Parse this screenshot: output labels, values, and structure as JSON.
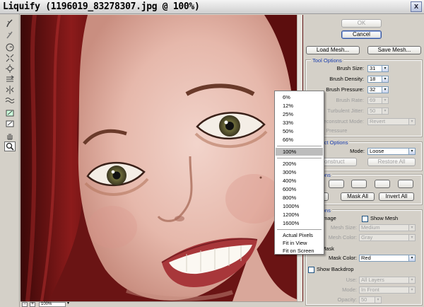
{
  "window": {
    "title": "Liquify (1196019_83278307.jpg @ 100%)",
    "close_glyph": "x"
  },
  "tools": [
    "warp-icon",
    "reconstruct-icon",
    "twirl-icon",
    "pucker-icon",
    "bloat-icon",
    "push-left-icon",
    "mirror-icon",
    "turbulence-icon",
    "freeze-mask-icon",
    "thaw-mask-icon",
    "hand-icon",
    "zoom-icon"
  ],
  "dialog": {
    "ok": "OK",
    "cancel": "Cancel",
    "load_mesh": "Load Mesh...",
    "save_mesh": "Save Mesh..."
  },
  "tool_options": {
    "title": "Tool Options",
    "brush_size_label": "Brush Size:",
    "brush_size": "31",
    "brush_density_label": "Brush Density:",
    "brush_density": "18",
    "brush_pressure_label": "Brush Pressure:",
    "brush_pressure": "32",
    "brush_rate_label": "Brush Rate:",
    "brush_rate": "69",
    "turbulent_jitter_label": "Turbulent Jitter:",
    "turbulent_jitter": "50",
    "reconstruct_mode_label": "Reconstruct Mode:",
    "reconstruct_mode": "Revert",
    "stylus_pressure_label": "e Pressure"
  },
  "reconstruct_options": {
    "title": "nstruct Options",
    "mode_label": "Mode:",
    "mode": "Loose",
    "reconstruct_btn": "econstruct",
    "restore_all_btn": "Restore All"
  },
  "mask_options": {
    "title": "Options",
    "none_btn": "one",
    "mask_all_btn": "Mask All",
    "invert_all_btn": "Invert All"
  },
  "view_options": {
    "title": "Options",
    "show_image_label": "Image",
    "show_mesh_label": "Show Mesh",
    "mesh_size_label": "Mesh Size:",
    "mesh_size": "Medium",
    "mesh_color_label": "Mesh Color:",
    "mesh_color": "Gray",
    "show_mask_label": "Mask",
    "mask_color_label": "Mask Color:",
    "mask_color": "Red",
    "show_backdrop_label": "Show Backdrop",
    "use_label": "Use:",
    "use": "All Layers",
    "backdrop_mode_label": "Mode:",
    "backdrop_mode": "In Front",
    "opacity_label": "Opacity:",
    "opacity": "50"
  },
  "zoom_menu": {
    "items": [
      "6%",
      "12%",
      "25%",
      "33%",
      "50%",
      "66%",
      "100%",
      "200%",
      "300%",
      "400%",
      "600%",
      "800%",
      "1000%",
      "1200%",
      "1600%",
      "Actual Pixels",
      "Fit in View",
      "Fit on Screen"
    ],
    "selected": "100%"
  },
  "status": {
    "zoom": "100%",
    "minus": "−",
    "plus": "+",
    "arrow": "▾"
  },
  "drop_glyph": "▾"
}
